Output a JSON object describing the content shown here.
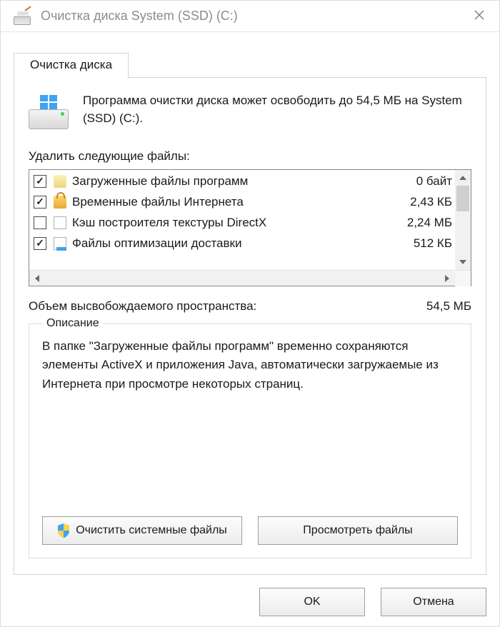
{
  "window": {
    "title": "Очистка диска System (SSD) (C:)"
  },
  "tab": {
    "label": "Очистка диска"
  },
  "info": {
    "text": "Программа очистки диска может освободить до 54,5 МБ на System (SSD) (C:)."
  },
  "list": {
    "label": "Удалить следующие файлы:",
    "items": [
      {
        "checked": true,
        "icon": "folder",
        "label": "Загруженные файлы программ",
        "size": "0 байт"
      },
      {
        "checked": true,
        "icon": "lock",
        "label": "Временные файлы Интернета",
        "size": "2,43 КБ"
      },
      {
        "checked": false,
        "icon": "file",
        "label": "Кэш построителя текстуры DirectX",
        "size": "2,24 МБ"
      },
      {
        "checked": true,
        "icon": "file",
        "label": "Файлы оптимизации доставки",
        "size": "512 КБ"
      }
    ]
  },
  "gain": {
    "label": "Объем высвобождаемого пространства:",
    "value": "54,5 МБ"
  },
  "description": {
    "legend": "Описание",
    "text": "В папке \"Загруженные файлы программ\" временно сохраняются элементы ActiveX и приложения Java, автоматически загружаемые из Интернета при просмотре некоторых страниц."
  },
  "buttons": {
    "clean_system": "Очистить системные файлы",
    "view_files": "Просмотреть файлы",
    "ok": "OK",
    "cancel": "Отмена"
  }
}
